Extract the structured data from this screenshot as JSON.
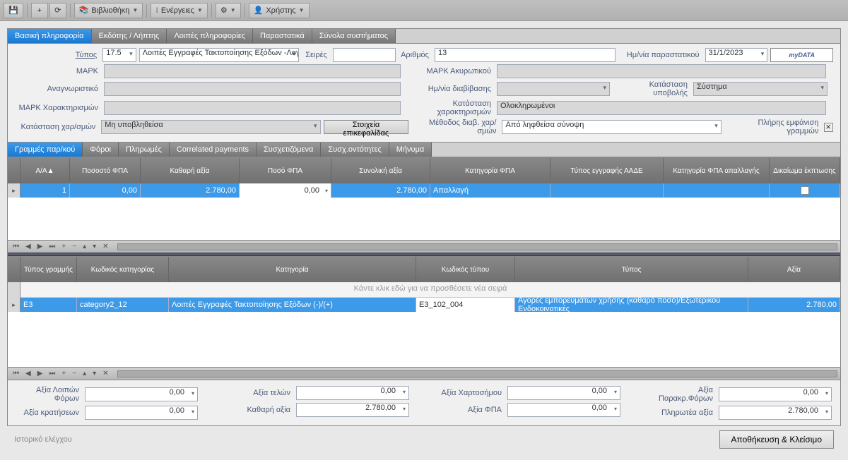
{
  "toolbar": {
    "library": "Βιβλιοθήκη",
    "actions": "Ενέργειες",
    "user": "Χρήστης"
  },
  "tabs": {
    "basic": "Βασική πληροφορία",
    "issuer": "Εκδότης / Λήπτης",
    "other": "Λοιπές πληροφορίες",
    "docs": "Παραστατικά",
    "totals": "Σύνολα συστήματος"
  },
  "form": {
    "type_lbl": "Τύπος",
    "type_code": "17.5",
    "type_desc": "Λοιπές Εγγραφές Τακτοποίησης Εξόδων -Λογιστ...",
    "series_lbl": "Σειρές",
    "series_val": "",
    "number_lbl": "Αριθμός",
    "number_val": "13",
    "docdate_lbl": "Ημ/νία παραστατικού",
    "docdate_val": "31/1/2023",
    "mydata": "myDATA",
    "mark_lbl": "ΜΑΡΚ",
    "mark_val": "",
    "cancelmark_lbl": "ΜΑΡΚ Ακυρωτικού",
    "cancelmark_val": "",
    "id_lbl": "Αναγνωριστικό",
    "id_val": "",
    "transdate_lbl": "Ημ/νία διαβίβασης",
    "transdate_val": "",
    "status_lbl": "Κατάσταση υποβολής",
    "status_val": "Σύστημα",
    "charmark_lbl": "ΜΑΡΚ Χαρακτηρισμών",
    "charmark_val": "",
    "charstatus_lbl": "Κατάσταση χαρακτηρισμών",
    "charstatus_val": "Ολοκληρωμένοι",
    "charsub_lbl": "Κατάσταση χαρ/σμών",
    "charsub_val": "Μη υποβληθείσα",
    "header_btn": "Στοιχεία επικεφαλίδας",
    "method_lbl": "Μέθοδος διαβ. χαρ/σμών",
    "method_val": "Από ληφθείσα σύνοψη",
    "fulllines_lbl": "Πλήρης εμφάνιση γραμμών"
  },
  "subtabs": {
    "lines": "Γραμμές παρ/κού",
    "taxes": "Φόροι",
    "payments": "Πληρωμές",
    "corr": "Correlated payments",
    "related": "Συσχετιζόμενα",
    "relents": "Συσχ.οντότητες",
    "message": "Μήνυμα"
  },
  "grid1": {
    "headers": {
      "aa": "Α/Α",
      "vat_pct": "Ποσοστό ΦΠΑ",
      "net": "Καθαρή αξία",
      "vat_amt": "Ποσό ΦΠΑ",
      "total": "Συνολική αξία",
      "vat_cat": "Κατηγορία ΦΠΑ",
      "aade": "Τύπος εγγραφής ΑΑΔΕ",
      "vat_exemp": "Κατηγορία ΦΠΑ απαλλαγής",
      "deduct": "Δικαίωμα έκπτωσης"
    },
    "row": {
      "aa": "1",
      "vat_pct": "0,00",
      "net": "2.780,00",
      "vat_amt": "0,00",
      "total": "2.780,00",
      "vat_cat": "Απαλλαγή",
      "aade": "",
      "vat_exemp": "",
      "deduct": false
    }
  },
  "grid2": {
    "headers": {
      "linetype": "Τύπος γραμμής",
      "catcode": "Κωδικός κατηγορίας",
      "category": "Κατηγορία",
      "typecode": "Κωδικός τύπου",
      "type": "Τύπος",
      "value": "Αξία"
    },
    "placeholder": "Κάντε κλικ εδώ για να προσθέσετε νέα σειρά",
    "row": {
      "linetype": "E3",
      "catcode": "category2_12",
      "category": "Λοιπές Εγγραφές Τακτοποίησης Εξόδων (-)/(+)",
      "typecode": "E3_102_004",
      "type": "Αγορές εμπορευμάτων χρήσης (καθαρό ποσό)/Εξωτερικού Ενδοκοινοτικές",
      "value": "2.780,00"
    }
  },
  "totals": {
    "other_taxes_lbl": "Αξία Λοιπών Φόρων",
    "other_taxes_val": "0,00",
    "withhold_lbl": "Αξία κρατήσεων",
    "withhold_val": "0,00",
    "fees_lbl": "Αξία τελών",
    "fees_val": "0,00",
    "net_lbl": "Καθαρή αξία",
    "net_val": "2.780,00",
    "stamp_lbl": "Αξία Χαρτοσήμου",
    "stamp_val": "0,00",
    "vat_lbl": "Αξία ΦΠΑ",
    "vat_val": "0,00",
    "paratax_lbl": "Αξία Παρακρ.Φόρων",
    "paratax_val": "0,00",
    "payable_lbl": "Πληρωτέα αξία",
    "payable_val": "2.780,00"
  },
  "footer": {
    "history": "Ιστορικό ελέγχου",
    "save": "Αποθήκευση & Κλείσιμο"
  }
}
